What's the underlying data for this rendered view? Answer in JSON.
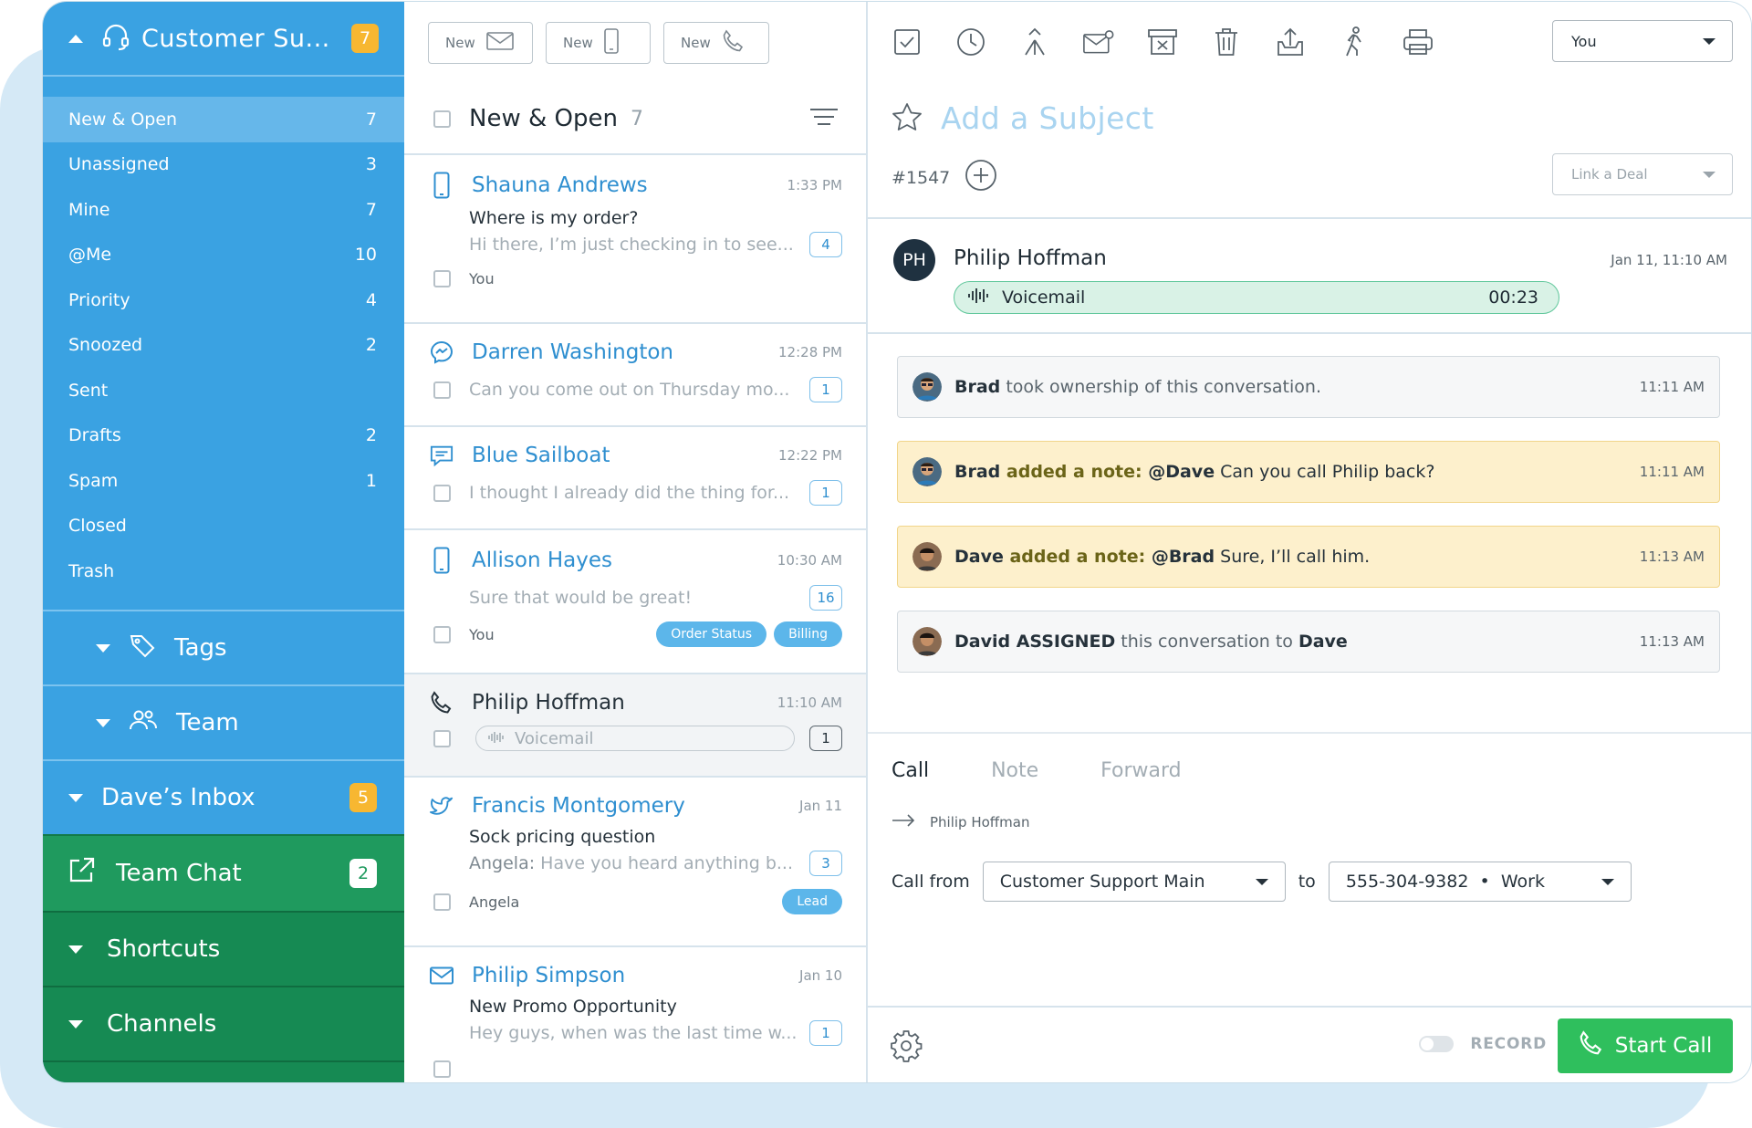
{
  "sidebar": {
    "header": {
      "title": "Customer Su...",
      "badge": "7"
    },
    "folders": [
      {
        "label": "New & Open",
        "count": "7"
      },
      {
        "label": "Unassigned",
        "count": "3"
      },
      {
        "label": "Mine",
        "count": "7"
      },
      {
        "label": "@Me",
        "count": "10"
      },
      {
        "label": "Priority",
        "count": "4"
      },
      {
        "label": "Snoozed",
        "count": "2"
      },
      {
        "label": "Sent",
        "count": ""
      },
      {
        "label": "Drafts",
        "count": "2"
      },
      {
        "label": "Spam",
        "count": "1"
      },
      {
        "label": "Closed",
        "count": ""
      },
      {
        "label": "Trash",
        "count": ""
      }
    ],
    "tags_label": "Tags",
    "team_label": "Team",
    "daves_inbox": {
      "label": "Dave’s Inbox",
      "badge": "5"
    },
    "team_chat": {
      "label": "Team Chat",
      "badge": "2"
    },
    "shortcuts_label": "Shortcuts",
    "channels_label": "Channels"
  },
  "list": {
    "new_buttons": [
      "New",
      "New",
      "New"
    ],
    "title": "New & Open",
    "count": "7",
    "conversations": [
      {
        "name": "Shauna Andrews",
        "time": "1:33 PM",
        "subject": "Where is my order?",
        "preview": "Hi there, I’m just checking in to see...",
        "count": "4",
        "owner": "You"
      },
      {
        "name": "Darren Washington",
        "time": "12:28 PM",
        "preview": "Can you come out on Thursday mo...",
        "count": "1"
      },
      {
        "name": "Blue Sailboat",
        "time": "12:22 PM",
        "preview": "I thought I already did the thing for...",
        "count": "1"
      },
      {
        "name": "Allison Hayes",
        "time": "10:30 AM",
        "preview": "Sure that would be great!",
        "count": "16",
        "owner": "You",
        "tags": [
          "Order Status",
          "Billing"
        ]
      },
      {
        "name": "Philip Hoffman",
        "time": "11:10 AM",
        "preview": "Voicemail",
        "count": "1"
      },
      {
        "name": "Francis Montgomery",
        "time": "Jan 11",
        "subject": "Sock pricing question",
        "preview_author": "Angela:",
        "preview": "Have you heard anything b...",
        "count": "3",
        "owner": "Angela",
        "tags": [
          "Lead"
        ]
      },
      {
        "name": "Philip Simpson",
        "time": "Jan 10",
        "subject": "New Promo Opportunity",
        "preview": "Hey guys, when was the last time w...",
        "count": "1"
      }
    ]
  },
  "detail": {
    "assignee": "You",
    "subject_placeholder": "Add a Subject",
    "conversation_id": "#1547",
    "link_deal": "Link a Deal",
    "message": {
      "initials": "PH",
      "from": "Philip Hoffman",
      "datetime": "Jan 11, 11:10 AM",
      "voicemail_label": "Voicemail",
      "voicemail_duration": "00:23"
    },
    "events": [
      {
        "actor": "Brad",
        "text": " took ownership of this conversation.",
        "time": "11:11 AM"
      },
      {
        "actor": "Brad",
        "action": " added a note: ",
        "mention": "@Dave",
        "text": " Can you call Philip back?",
        "time": "11:11 AM"
      },
      {
        "actor": "Dave",
        "action": " added a note: ",
        "mention": "@Brad",
        "text": " Sure, I’ll call him.",
        "time": "11:13 AM"
      },
      {
        "actor": "David ASSIGNED",
        "text": " this conversation to ",
        "target": "Dave",
        "time": "11:13 AM"
      }
    ],
    "compose": {
      "tabs": [
        "Call",
        "Note",
        "Forward"
      ],
      "to_name": "Philip Hoffman",
      "call_from_label": "Call from",
      "call_from_value": "Customer Support Main",
      "to_label": "to",
      "to_number": "555-304-9382",
      "to_type": "Work",
      "separator": "•"
    },
    "footer": {
      "record_label": "RECORD",
      "start_call_label": "Start Call"
    }
  },
  "colors": {
    "sidebar_blue": "#3aa2e2",
    "sidebar_green": "#1f9a5e",
    "accent_blue": "#2f8fd0",
    "badge_yellow": "#f7b731",
    "start_call_green": "#2fbf5d",
    "note_yellow": "#fdf0cc"
  }
}
